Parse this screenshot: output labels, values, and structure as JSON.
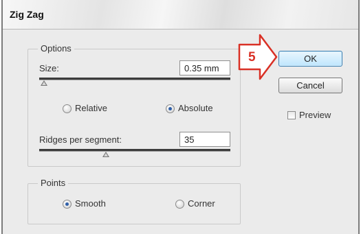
{
  "dialog": {
    "title": "Zig Zag",
    "options_legend": "Options",
    "size_label": "Size:",
    "size_value": "0.35 mm",
    "relative_label": "Relative",
    "absolute_label": "Absolute",
    "mode_selected": "Absolute",
    "ridges_label": "Ridges per segment:",
    "ridges_value": "35",
    "points_legend": "Points",
    "smooth_label": "Smooth",
    "corner_label": "Corner",
    "points_selected": "Smooth",
    "ok_label": "OK",
    "cancel_label": "Cancel",
    "preview_label": "Preview",
    "preview_checked": false
  },
  "annotation": {
    "step_number": "5",
    "color": "#d93025"
  }
}
